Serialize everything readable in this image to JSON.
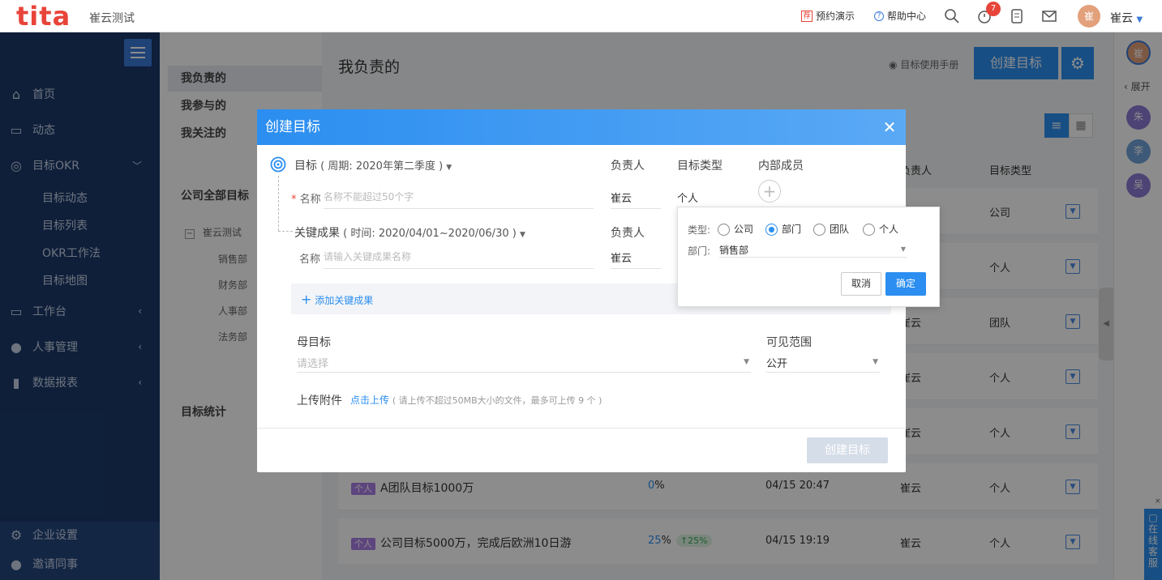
{
  "topbar": {
    "logo": "tita",
    "company": "崔云测试",
    "demo_label": "预约演示",
    "help_label": "帮助中心",
    "notif_count": "7",
    "user_avatar": "崔",
    "user_name": "崔云"
  },
  "sidebar": {
    "items": [
      {
        "label": "首页",
        "icon": "home-icon"
      },
      {
        "label": "动态",
        "icon": "chat-icon"
      },
      {
        "label": "目标OKR",
        "icon": "target-icon"
      },
      {
        "label": "工作台",
        "icon": "monitor-icon"
      },
      {
        "label": "人事管理",
        "icon": "person-icon"
      },
      {
        "label": "数据报表",
        "icon": "bar-chart-icon"
      }
    ],
    "okr_sub": [
      "目标动态",
      "目标列表",
      "OKR工作法",
      "目标地图"
    ],
    "settings_label": "企业设置",
    "invite_label": "邀请同事"
  },
  "panel2": {
    "mine": "我负责的",
    "joined": "我参与的",
    "followed": "我关注的",
    "all_company": "公司全部目标",
    "tree_root": "崔云测试",
    "tree_children": [
      "销售部",
      "财务部",
      "人事部",
      "法务部"
    ],
    "stats": "目标统计"
  },
  "main": {
    "title": "我负责的",
    "manual_label": "目标使用手册",
    "create_btn": "创建目标",
    "col_owner": "负责人",
    "col_type": "目标类型",
    "rows": [
      {
        "owner": "",
        "type": "公司"
      },
      {
        "owner": "",
        "type": "个人"
      },
      {
        "owner": "崔云",
        "type": "团队"
      },
      {
        "owner": "崔云",
        "type": "个人"
      },
      {
        "owner": "崔云",
        "type": "个人"
      },
      {
        "tag": "个人",
        "name": "A团队目标1000万",
        "progress": "0",
        "pct": "%",
        "time": "04/15 20:47",
        "owner": "崔云",
        "type": "个人"
      },
      {
        "tag": "个人",
        "name": "公司目标5000万，完成后欧洲10日游",
        "progress": "25",
        "pct": "%",
        "delta": "↑25%",
        "time": "04/15 19:19",
        "owner": "崔云",
        "type": "个人"
      }
    ]
  },
  "rightstrip": {
    "me": "崔",
    "expand": "展开",
    "users": [
      "朱",
      "李",
      "吴"
    ],
    "service": "在线客服"
  },
  "modal": {
    "title": "创建目标",
    "objective_label": "目标",
    "period": "( 周期: 2020年第二季度 )",
    "owner_header": "负责人",
    "type_header": "目标类型",
    "members_header": "内部成员",
    "name_label": "名称",
    "name_placeholder": "名称不能超过50个字",
    "owner_value": "崔云",
    "type_value": "个人",
    "kr_label": "关键成果",
    "kr_period": "( 时间: 2020/04/01~2020/06/30 )",
    "kr_owner_header": "负责人",
    "kr_name_label": "名称",
    "kr_placeholder": "请输入关键成果名称",
    "kr_owner_value": "崔云",
    "add_kr": "添加关键成果",
    "parent_label": "母目标",
    "parent_placeholder": "请选择",
    "visibility_label": "可见范围",
    "visibility_value": "公开",
    "attach_label": "上传附件",
    "attach_link": "点击上传",
    "attach_hint": "( 请上传不超过50MB大小的文件，最多可上传 9 个 )",
    "submit": "创建目标"
  },
  "popover": {
    "type_label": "类型:",
    "options": [
      "公司",
      "部门",
      "团队",
      "个人"
    ],
    "selected": "部门",
    "dept_label": "部门:",
    "dept_value": "销售部",
    "cancel": "取消",
    "ok": "确定"
  }
}
